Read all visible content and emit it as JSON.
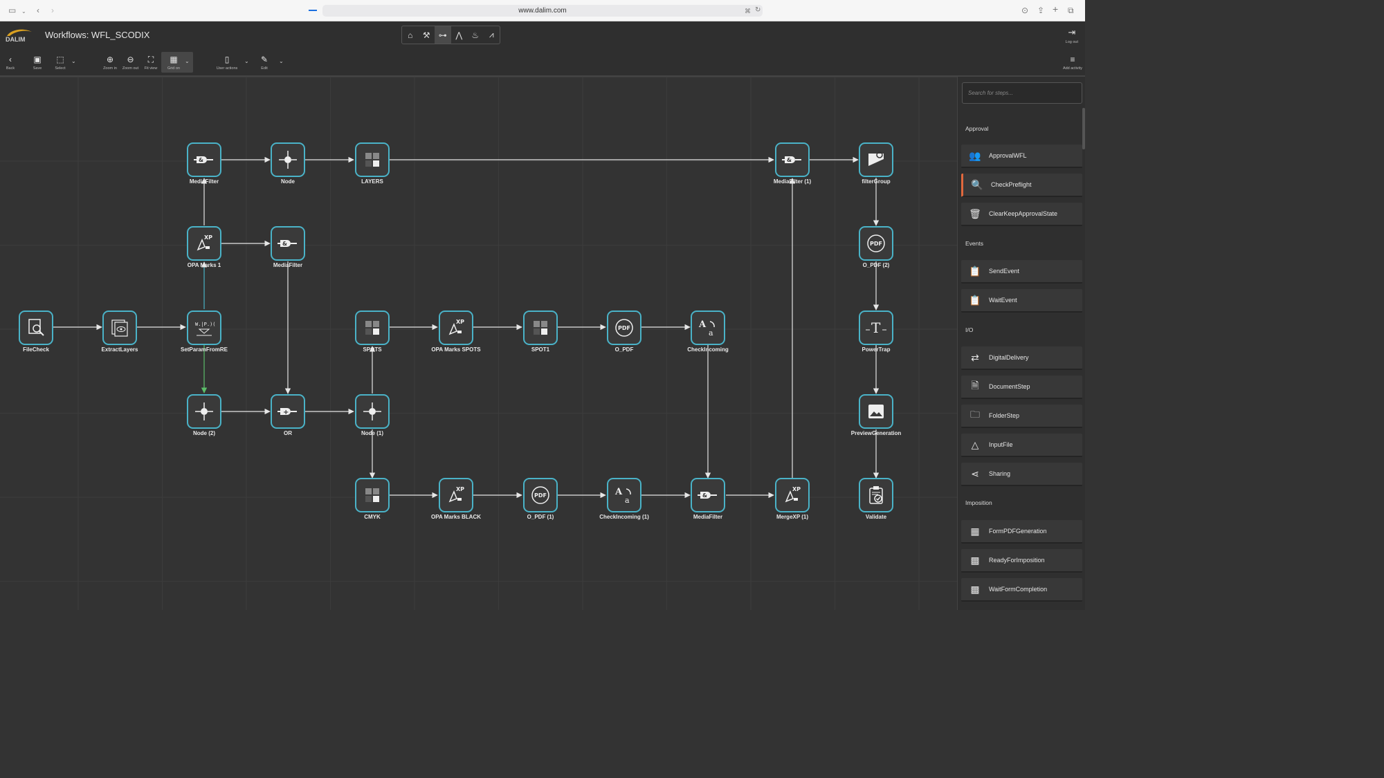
{
  "browser": {
    "url": "www.dalim.com"
  },
  "app": {
    "logo_text": "DALIM",
    "title": "Workflows: WFL_SCODIX",
    "logout_label": "Log out"
  },
  "toolbar": {
    "back": "Back",
    "save": "Save",
    "select": "Select",
    "zoom_in": "Zoom in",
    "zoom_out": "Zoom out",
    "fit_view": "Fit view",
    "grid_on": "Grid on",
    "user_actions": "User actions",
    "edit": "Edit",
    "add_activity": "Add activity"
  },
  "nodes": {
    "mediafilter_top": "MediaFilter",
    "node_top": "Node",
    "layers": "LAYERS",
    "mediafilter_1": "MediaFilter (1)",
    "filtergroup": "filterGroup",
    "opa_marks_1": "OPA Marks 1",
    "mediafilter_mid": "MediaFilter",
    "o_pdf_2": "O_PDF (2)",
    "filecheck": "FileCheck",
    "extractlayers": "ExtractLayers",
    "setparamfromre": "SetParamFromRE",
    "spots": "SPOTS",
    "opa_marks_spots": "OPA Marks SPOTS",
    "spot1": "SPOT1",
    "o_pdf": "O_PDF",
    "checkincoming": "CheckIncoming",
    "powertrap": "PowerTrap",
    "node_2": "Node (2)",
    "or": "OR",
    "node_1": "Node (1)",
    "previewgeneration": "PreviewGeneration",
    "cmyk": "CMYK",
    "opa_marks_black": "OPA Marks BLACK",
    "o_pdf_1": "O_PDF (1)",
    "checkincoming_1": "CheckIncoming (1)",
    "mediafilter_bottom": "MediaFilter",
    "mergexp_1": "MergeXP (1)",
    "validate": "Validate"
  },
  "sidebar": {
    "search_placeholder": "Search for steps...",
    "groups": {
      "approval": "Approval",
      "events": "Events",
      "io": "I/O",
      "imposition": "Imposition"
    },
    "steps": {
      "approvalwfl": "ApprovalWFL",
      "checkpreflight": "CheckPreflight",
      "clearkeep": "ClearKeepApprovalState",
      "sendevent": "SendEvent",
      "waitevent": "WaitEvent",
      "digitaldelivery": "DigitalDelivery",
      "documentstep": "DocumentStep",
      "folderstep": "FolderStep",
      "inputfile": "InputFile",
      "sharing": "Sharing",
      "formpdf": "FormPDFGeneration",
      "readyforimposition": "ReadyForImposition",
      "waitformcompletion": "WaitFormCompletion"
    },
    "selected_step": "CheckPreflight"
  },
  "colors": {
    "node_border": "#4ab3c8",
    "selected_accent": "#e0683d",
    "active_edge": "#5cbf6a"
  }
}
